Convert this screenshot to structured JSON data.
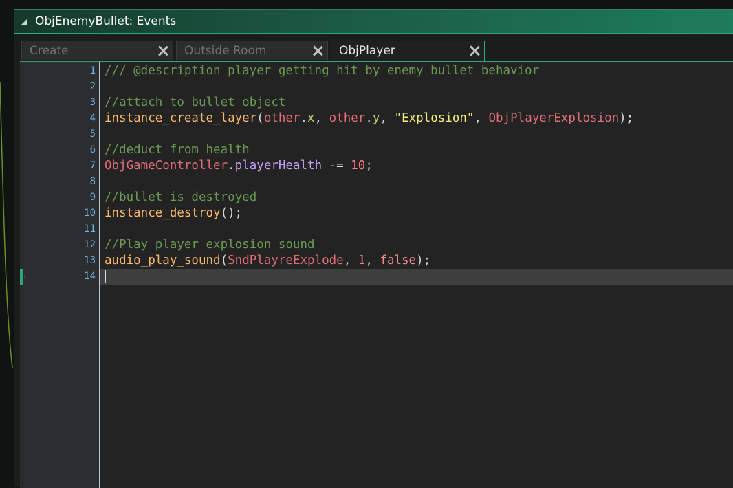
{
  "window": {
    "title": "ObjEnemyBullet: Events"
  },
  "tabs": [
    {
      "label": "Create",
      "active": false
    },
    {
      "label": "Outside Room",
      "active": false
    },
    {
      "label": "ObjPlayer",
      "active": true
    }
  ],
  "editor": {
    "current_line": 14,
    "lines": [
      {
        "num": "1",
        "tokens": [
          {
            "t": "/// @description player getting hit by enemy bullet behavior",
            "c": "comment"
          }
        ]
      },
      {
        "num": "2",
        "tokens": []
      },
      {
        "num": "3",
        "tokens": [
          {
            "t": "//attach to bullet object",
            "c": "comment"
          }
        ]
      },
      {
        "num": "4",
        "tokens": [
          {
            "t": "instance_create_layer",
            "c": "func"
          },
          {
            "t": "(",
            "c": "punct"
          },
          {
            "t": "other",
            "c": "obj"
          },
          {
            "t": ".",
            "c": "punct"
          },
          {
            "t": "x",
            "c": "var"
          },
          {
            "t": ", ",
            "c": "punct"
          },
          {
            "t": "other",
            "c": "obj"
          },
          {
            "t": ".",
            "c": "punct"
          },
          {
            "t": "y",
            "c": "var"
          },
          {
            "t": ", ",
            "c": "punct"
          },
          {
            "t": "\"Explosion\"",
            "c": "str"
          },
          {
            "t": ", ",
            "c": "punct"
          },
          {
            "t": "ObjPlayerExplosion",
            "c": "obj"
          },
          {
            "t": ");",
            "c": "punct"
          }
        ]
      },
      {
        "num": "5",
        "tokens": []
      },
      {
        "num": "6",
        "tokens": [
          {
            "t": "//deduct from health",
            "c": "comment"
          }
        ]
      },
      {
        "num": "7",
        "tokens": [
          {
            "t": "ObjGameController",
            "c": "obj"
          },
          {
            "t": ".",
            "c": "punct"
          },
          {
            "t": "playerHealth",
            "c": "prop"
          },
          {
            "t": " -= ",
            "c": "plain"
          },
          {
            "t": "10",
            "c": "num"
          },
          {
            "t": ";",
            "c": "punct"
          }
        ]
      },
      {
        "num": "8",
        "tokens": []
      },
      {
        "num": "9",
        "tokens": [
          {
            "t": "//bullet is destroyed",
            "c": "comment"
          }
        ]
      },
      {
        "num": "10",
        "tokens": [
          {
            "t": "instance_destroy",
            "c": "func"
          },
          {
            "t": "();",
            "c": "punct"
          }
        ]
      },
      {
        "num": "11",
        "tokens": []
      },
      {
        "num": "12",
        "tokens": [
          {
            "t": "//Play player explosion sound",
            "c": "comment"
          }
        ]
      },
      {
        "num": "13",
        "tokens": [
          {
            "t": "audio_play_sound",
            "c": "func"
          },
          {
            "t": "(",
            "c": "punct"
          },
          {
            "t": "SndPlayreExplode",
            "c": "obj"
          },
          {
            "t": ", ",
            "c": "punct"
          },
          {
            "t": "1",
            "c": "num"
          },
          {
            "t": ", ",
            "c": "punct"
          },
          {
            "t": "false",
            "c": "kw"
          },
          {
            "t": ");",
            "c": "punct"
          }
        ]
      },
      {
        "num": "14",
        "tokens": []
      }
    ]
  },
  "icons": {
    "collapse": "collapse-triangle-icon",
    "tab_close": "close-x-icon",
    "bookmark": "current-line-arrow-icon"
  },
  "colors": {
    "accent": "#2fa67c",
    "line_numbers": "#6db6e6",
    "comment": "#6a9a52",
    "function": "#ffb86c"
  }
}
